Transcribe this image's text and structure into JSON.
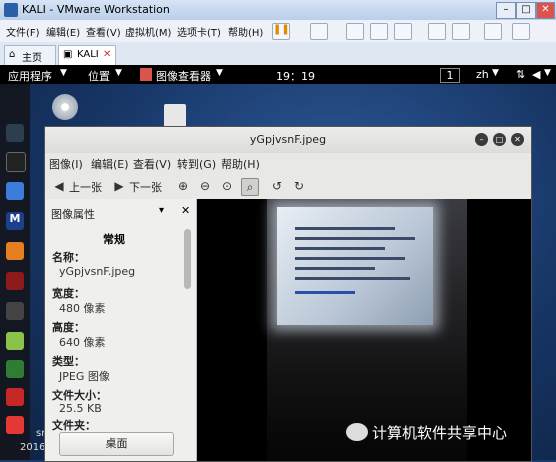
{
  "vmware": {
    "title": "KALI - VMware Workstation",
    "menu": [
      "文件(F)",
      "编辑(E)",
      "查看(V)",
      "虚拟机(M)",
      "选项卡(T)",
      "帮助(H)"
    ],
    "tabs": [
      {
        "label": "主页"
      },
      {
        "label": "KALI"
      }
    ]
  },
  "gnome": {
    "apps": "应用程序",
    "places": "位置",
    "viewer": "图像查看器",
    "clock": "19：19",
    "workspace": "1",
    "lang": "zh"
  },
  "viewer": {
    "title": "yGpjvsnF.jpeg",
    "menu": [
      "图像(I)",
      "编辑(E)",
      "查看(V)",
      "转到(G)",
      "帮助(H)"
    ],
    "prev": "上一张",
    "next": "下一张",
    "sidebar": {
      "header": "图像属性",
      "section": "常规",
      "name_label": "名称：",
      "name": "yGpjvsnF.jpeg",
      "width_label": "宽度：",
      "width": "480 像素",
      "height_label": "高度：",
      "height": "640 像素",
      "type_label": "类型：",
      "type": "JPEG 图像",
      "size_label": "文件大小：",
      "size": "25.5 KB",
      "folder_label": "文件夹：",
      "folder_button": "桌面"
    }
  },
  "watermark": "计算机软件共享中心",
  "desktop_fragment": "2016"
}
